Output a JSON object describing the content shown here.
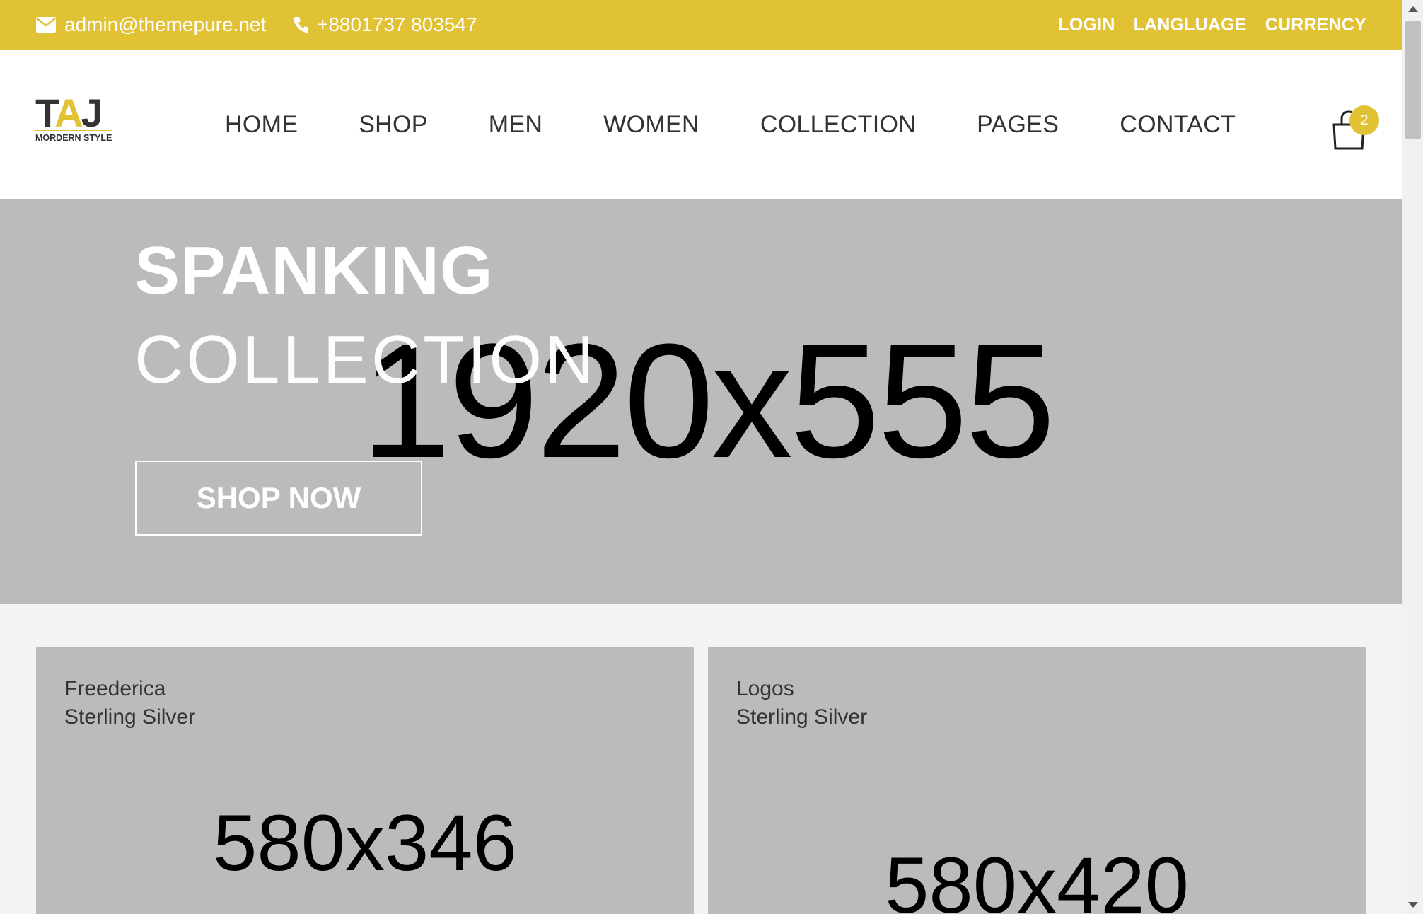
{
  "topbar": {
    "email": "admin@themepure.net",
    "phone": "+8801737 803547",
    "links": [
      "LOGIN",
      "LANGLUAGE",
      "CURRENCY"
    ]
  },
  "logo": {
    "mark": "TAJ",
    "tagline": "MORDERN STYLE"
  },
  "nav": {
    "items": [
      "HOME",
      "SHOP",
      "MEN",
      "WOMEN",
      "COLLECTION",
      "PAGES",
      "CONTACT"
    ]
  },
  "cart": {
    "count": "2",
    "icon": "shopping-bag-icon"
  },
  "hero": {
    "title": "SPANKING",
    "subtitle": "COLLECTION",
    "placeholder": "1920x555",
    "button": "SHOP NOW"
  },
  "banners": [
    {
      "line1": "Freederica",
      "line2": "Sterling Silver",
      "placeholder": "580x346"
    },
    {
      "line1": "Logos",
      "line2": "Sterling Silver",
      "placeholder": "580x420"
    }
  ],
  "colors": {
    "accent": "#e1c234",
    "placeholder_bg": "#bbbbbb",
    "text": "#333333"
  }
}
